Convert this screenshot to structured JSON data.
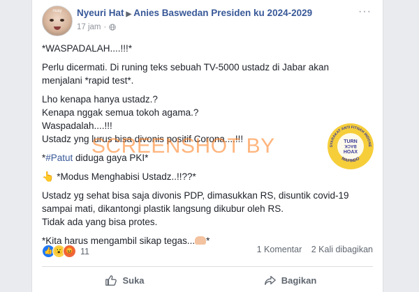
{
  "post": {
    "author": "Nyeuri Hat",
    "group": "Anies Baswedan Presiden ku 2024-2029",
    "time": "17 jam",
    "time_dot": "·",
    "avatar_caption": "nuay",
    "more_icon": "more-horizontal-icon",
    "lines": {
      "l1": "*WASPADALAH....!!!*",
      "l2": "Perlu dicermati. Di runing teks sebuah TV-5000 ustadz di Jabar akan",
      "l3": "menjalani *rapid test*.",
      "l4": "Lho kenapa hanya ustadz.?",
      "l5": "Kenapa nggak semua tokoh agama.?",
      "l6": "Waspadalah....!!!",
      "l7": "Ustadz yng lurus bisa divonis positif Corona....!!!",
      "l8_prefix": "*",
      "l8_hashtag": "#Patut",
      "l8_rest": " diduga gaya PKI*",
      "l9": " *Modus Menghabisi Ustadz..!!??*",
      "l10": "Ustadz yg sehat bisa saja divonis PDP, dimasukkan RS, disuntik covid-19",
      "l11": "sampai mati, dikantongi plastik langsung dikubur oleh RS.",
      "l12": "Tidak ada yang bisa protes.",
      "l13": "*Kita harus mengambil sikap tegas...",
      "l13_end": "*"
    }
  },
  "watermark": {
    "text": "SCREENSHOT BY",
    "seal_top": "MASYARAKAT ANTI FITNAH INDONESIA",
    "seal_center_1": "TURN",
    "seal_center_2": "BACK",
    "seal_center_3": "HOAX",
    "seal_bottom": "MAFINDO"
  },
  "stats": {
    "reaction_count": "11",
    "comments": "1 Komentar",
    "shares": "2 Kali dibagikan"
  },
  "actions": {
    "like": "Suka",
    "share": "Bagikan"
  },
  "colors": {
    "link": "#385898",
    "watermark": "#ff7814",
    "seal_yellow": "#f5c518",
    "seal_blue": "#3b3b9a"
  }
}
